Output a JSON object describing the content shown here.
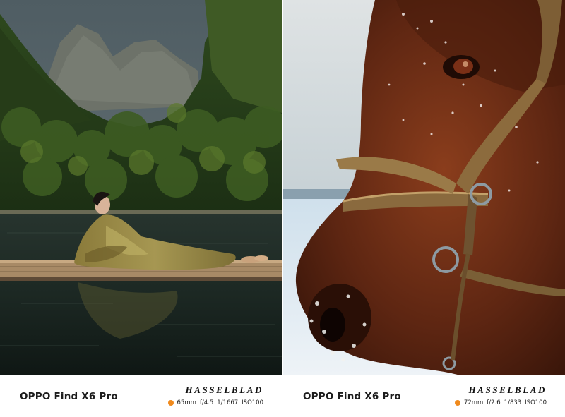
{
  "panels": [
    {
      "model": "OPPO Find X6 Pro",
      "brand": "HASSELBLAD",
      "exif": {
        "focal": "65mm",
        "aperture": "f/4.5",
        "shutter": "1/1667",
        "iso": "ISO100"
      },
      "accent_color": "#f08a1d"
    },
    {
      "model": "OPPO Find X6 Pro",
      "brand": "HASSELBLAD",
      "exif": {
        "focal": "72mm",
        "aperture": "f/2.6",
        "shutter": "1/833",
        "iso": "ISO100"
      },
      "accent_color": "#f08a1d"
    }
  ]
}
